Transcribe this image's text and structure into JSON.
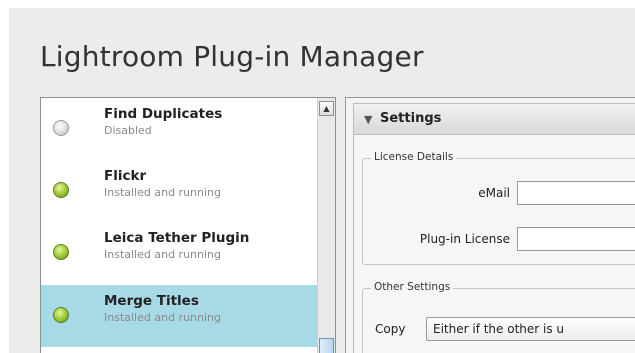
{
  "app": {
    "title": "Lightroom Plug-in Manager"
  },
  "plugins": [
    {
      "name": "Find Duplicates",
      "status": "Disabled",
      "state": "disabled",
      "selected": false
    },
    {
      "name": "Flickr",
      "status": "Installed and running",
      "state": "running",
      "selected": false
    },
    {
      "name": "Leica Tether Plugin",
      "status": "Installed and running",
      "state": "running",
      "selected": false
    },
    {
      "name": "Merge Titles",
      "status": "Installed and running",
      "state": "running",
      "selected": true
    }
  ],
  "scrollbar": {
    "up_glyph": "▲"
  },
  "settings": {
    "toggle_glyph": "▼",
    "title": "Settings",
    "license_group": {
      "legend": "License Details",
      "email_label": "eMail",
      "email_value": "",
      "license_label": "Plug-in License",
      "license_value": ""
    },
    "other_group": {
      "legend": "Other Settings",
      "copy_label": "Copy",
      "copy_value": "Either if the other is u"
    }
  },
  "colors": {
    "selected_row": "#a8d9e6",
    "running_dot": "#8cbf2a",
    "disabled_dot": "#d6d6d6"
  }
}
